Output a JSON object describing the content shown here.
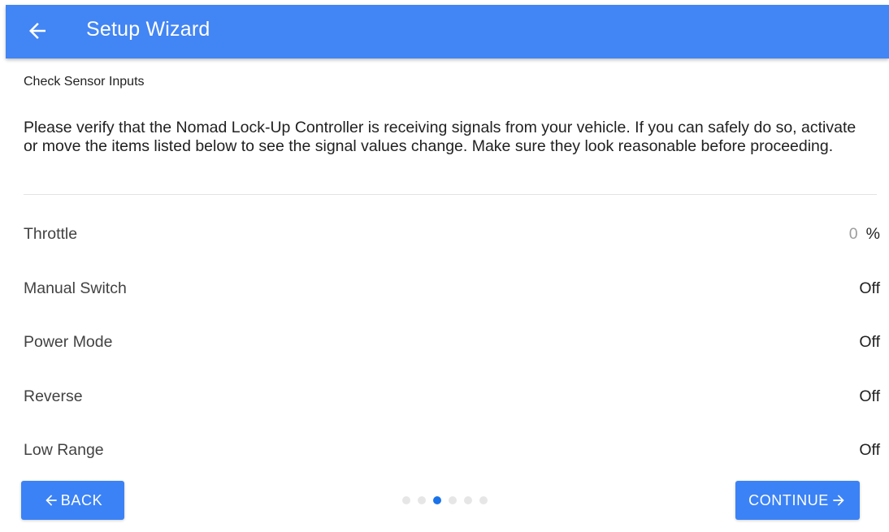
{
  "appbar": {
    "title": "Setup Wizard",
    "back_icon": "arrow-left-icon",
    "color": "#4285f4"
  },
  "subtitle": "Check Sensor Inputs",
  "intro": "Please verify that the Nomad Lock-Up Controller is receiving signals from your vehicle. If you can safely do so, activate or move the items listed below to see the signal values change. Make sure they look reasonable before proceeding.",
  "signals": [
    {
      "label": "Throttle",
      "value": "0",
      "unit": "%"
    },
    {
      "label": "Manual Switch",
      "value": "Off"
    },
    {
      "label": "Power Mode",
      "value": "Off"
    },
    {
      "label": "Reverse",
      "value": "Off"
    },
    {
      "label": "Low Range",
      "value": "Off"
    }
  ],
  "navigation": {
    "back_label": "BACK",
    "continue_label": "CONTINUE",
    "step_count": 6,
    "current_step": 3,
    "accent_color": "#3b82f6"
  }
}
